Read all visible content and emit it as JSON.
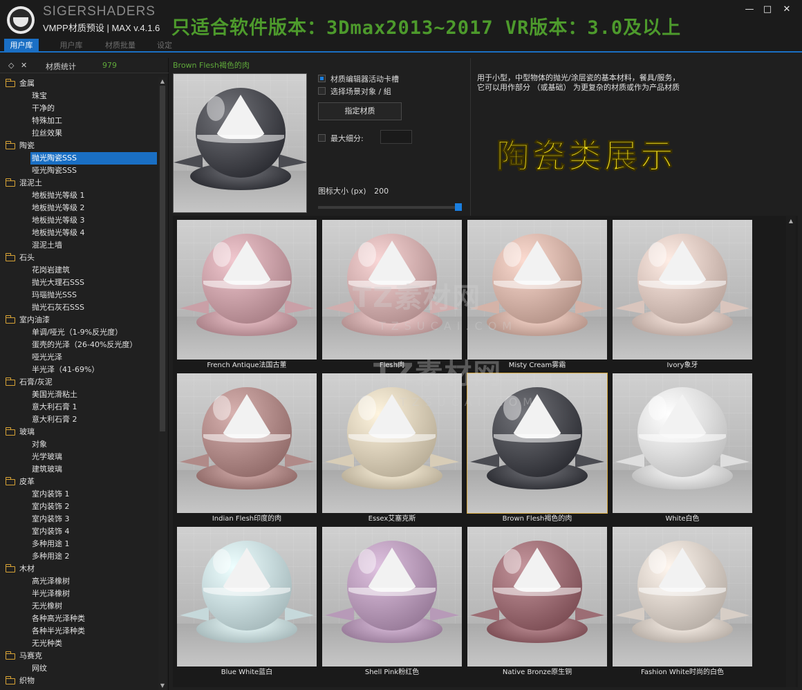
{
  "header": {
    "brand": "SIGERSHADERS",
    "subtitle": "VMPP材质预设 | MAX v.4.1.6",
    "banner": "只适合软件版本：3Dmax2013~2017  VR版本：3.0及以上",
    "minimize_icon": "minimize-icon",
    "maximize_icon": "maximize-icon",
    "close_icon": "close-icon"
  },
  "tabs": [
    {
      "label": "用户库"
    },
    {
      "label": "用户库"
    },
    {
      "label": "材质批量"
    },
    {
      "label": "设定"
    }
  ],
  "stats": {
    "label": "材质统计",
    "count": "979"
  },
  "tree": [
    {
      "type": "cat",
      "label": "金属"
    },
    {
      "type": "sub",
      "label": "珠宝"
    },
    {
      "type": "sub",
      "label": "干净的"
    },
    {
      "type": "sub",
      "label": "特殊加工"
    },
    {
      "type": "sub",
      "label": "拉丝效果"
    },
    {
      "type": "cat",
      "label": "陶瓷"
    },
    {
      "type": "sel",
      "label": "抛光陶瓷SSS"
    },
    {
      "type": "sub",
      "label": "哑光陶瓷SSS"
    },
    {
      "type": "cat",
      "label": "混泥土"
    },
    {
      "type": "sub",
      "label": "地板抛光等级 1"
    },
    {
      "type": "sub",
      "label": "地板抛光等级 2"
    },
    {
      "type": "sub",
      "label": "地板抛光等级 3"
    },
    {
      "type": "sub",
      "label": "地板抛光等级 4"
    },
    {
      "type": "sub",
      "label": "混泥土墙"
    },
    {
      "type": "cat",
      "label": "石头"
    },
    {
      "type": "sub",
      "label": "花岗岩建筑"
    },
    {
      "type": "sub",
      "label": "抛光大理石SSS"
    },
    {
      "type": "sub",
      "label": "玛瑙抛光SSS"
    },
    {
      "type": "sub",
      "label": "抛光石灰石SSS"
    },
    {
      "type": "cat",
      "label": "室内油漆"
    },
    {
      "type": "sub",
      "label": "单调/哑光（1-9%反光度）"
    },
    {
      "type": "sub",
      "label": "蛋壳的光泽（26-40%反光度）"
    },
    {
      "type": "sub",
      "label": "哑光光泽"
    },
    {
      "type": "sub",
      "label": "半光泽（41-69%）"
    },
    {
      "type": "cat",
      "label": "石膏/灰泥"
    },
    {
      "type": "sub",
      "label": "美国光滑粘土"
    },
    {
      "type": "sub",
      "label": "意大利石膏 1"
    },
    {
      "type": "sub",
      "label": "意大利石膏 2"
    },
    {
      "type": "cat",
      "label": "玻璃"
    },
    {
      "type": "sub",
      "label": "对象"
    },
    {
      "type": "sub",
      "label": "光学玻璃"
    },
    {
      "type": "sub",
      "label": "建筑玻璃"
    },
    {
      "type": "cat",
      "label": "皮革"
    },
    {
      "type": "sub",
      "label": "室内装饰 1"
    },
    {
      "type": "sub",
      "label": "室内装饰 2"
    },
    {
      "type": "sub",
      "label": "室内装饰 3"
    },
    {
      "type": "sub",
      "label": "室内装饰 4"
    },
    {
      "type": "sub",
      "label": "多种用途 1"
    },
    {
      "type": "sub",
      "label": "多种用途 2"
    },
    {
      "type": "cat",
      "label": "木材"
    },
    {
      "type": "sub",
      "label": "高光泽橡树"
    },
    {
      "type": "sub",
      "label": "半光泽橡树"
    },
    {
      "type": "sub",
      "label": "无光橡树"
    },
    {
      "type": "sub",
      "label": "各种高光泽种类"
    },
    {
      "type": "sub",
      "label": "各种半光泽种类"
    },
    {
      "type": "sub",
      "label": "无光种类"
    },
    {
      "type": "cat",
      "label": "马赛克"
    },
    {
      "type": "sub",
      "label": "网纹"
    },
    {
      "type": "cat",
      "label": "织物"
    }
  ],
  "selected_title": "Brown Flesh褐色的肉",
  "options": {
    "material_editor_slot": "材质编辑器活动卡槽",
    "select_scene_objects": "选择场景对象 / 組",
    "assign_button": "指定材质",
    "max_subdivs": "最大细分:",
    "icon_size_label": "图标大小 (px)",
    "icon_size_value": "200",
    "icon_size_fraction": 1.0
  },
  "description": {
    "line1": "用于小型，中型物体的抛光/涂层瓷的基本材料，餐具/服务，",
    "line2": "它可以用作部分 （或基础） 为更复杂的材质或作为产品材质"
  },
  "showcase": "陶瓷类展示",
  "watermark": {
    "main": "TZ素材网",
    "sub": "TZSUCAI.COM"
  },
  "materials": [
    {
      "name": "French Antique法国古董",
      "color": "#c9a0a7"
    },
    {
      "name": "Flesh肉",
      "color": "#d1aeae"
    },
    {
      "name": "Misty Cream雾霜",
      "color": "#d4b3a8"
    },
    {
      "name": "Ivory象牙",
      "color": "#d9c5bd"
    },
    {
      "name": "Indian Flesh印度的肉",
      "color": "#b08a88"
    },
    {
      "name": "Essex艾塞克斯",
      "color": "#d8cdb7"
    },
    {
      "name": "Brown Flesh褐色的肉",
      "color": "#4b4c52",
      "selected": true
    },
    {
      "name": "White白色",
      "color": "#dedede"
    },
    {
      "name": "Blue White蓝白",
      "color": "#c6d9db"
    },
    {
      "name": "Shell Pink粉红色",
      "color": "#b79ab8"
    },
    {
      "name": "Native Bronze原生铜",
      "color": "#9c6d74"
    },
    {
      "name": "Fashion White时尚的白色",
      "color": "#d7cec6"
    }
  ]
}
